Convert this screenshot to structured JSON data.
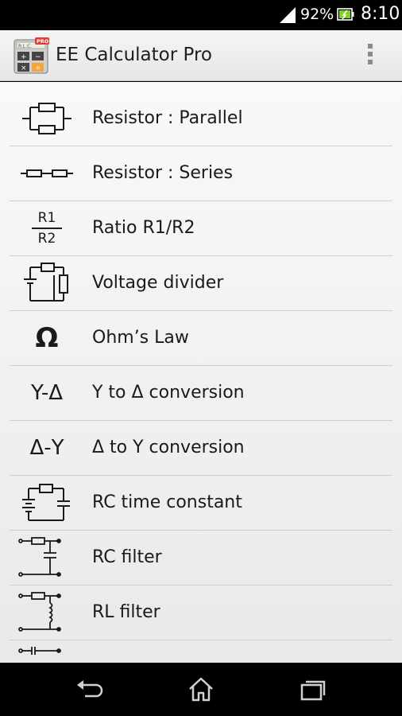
{
  "status_bar": {
    "battery_percent": "92%",
    "time": "8:10",
    "signal_icon": "signal-icon",
    "battery_icon": "battery-charging-icon"
  },
  "action_bar": {
    "title": "EE Calculator Pro",
    "app_icon": "calculator-app-icon",
    "app_icon_badge": "PRO",
    "app_icon_lettering": "R.L.C.",
    "overflow_icon": "overflow-menu-icon"
  },
  "items": [
    {
      "label": "Resistor : Parallel",
      "icon": "resistor-parallel-icon"
    },
    {
      "label": "Resistor : Series",
      "icon": "resistor-series-icon"
    },
    {
      "label": "Ratio R1/R2",
      "icon": "ratio-icon",
      "icon_top": "R1",
      "icon_bottom": "R2"
    },
    {
      "label": "Voltage divider",
      "icon": "voltage-divider-icon"
    },
    {
      "label": "Ohm’s Law",
      "icon": "omega-icon",
      "icon_text": "Ω"
    },
    {
      "label": "Y to Δ conversion",
      "icon": "y-delta-icon",
      "icon_text": "Y-Δ"
    },
    {
      "label": "Δ to Y conversion",
      "icon": "delta-y-icon",
      "icon_text": "Δ-Y"
    },
    {
      "label": "RC time constant",
      "icon": "rc-time-constant-icon"
    },
    {
      "label": "RC filter",
      "icon": "rc-filter-icon"
    },
    {
      "label": "RL filter",
      "icon": "rl-filter-icon"
    },
    {
      "label": "",
      "icon": "circuit-partial-icon"
    }
  ],
  "nav_bar": {
    "back_icon": "back-icon",
    "home_icon": "home-icon",
    "recents_icon": "recent-apps-icon"
  },
  "colors": {
    "status_bar_bg": "#000000",
    "action_bar_bg": "#eeeeee",
    "list_bg": "#f3f3f3",
    "divider": "#cfcfcf",
    "text": "#1a1a1a",
    "battery_fill": "#7ed321",
    "icon_badge": "#e53935"
  }
}
